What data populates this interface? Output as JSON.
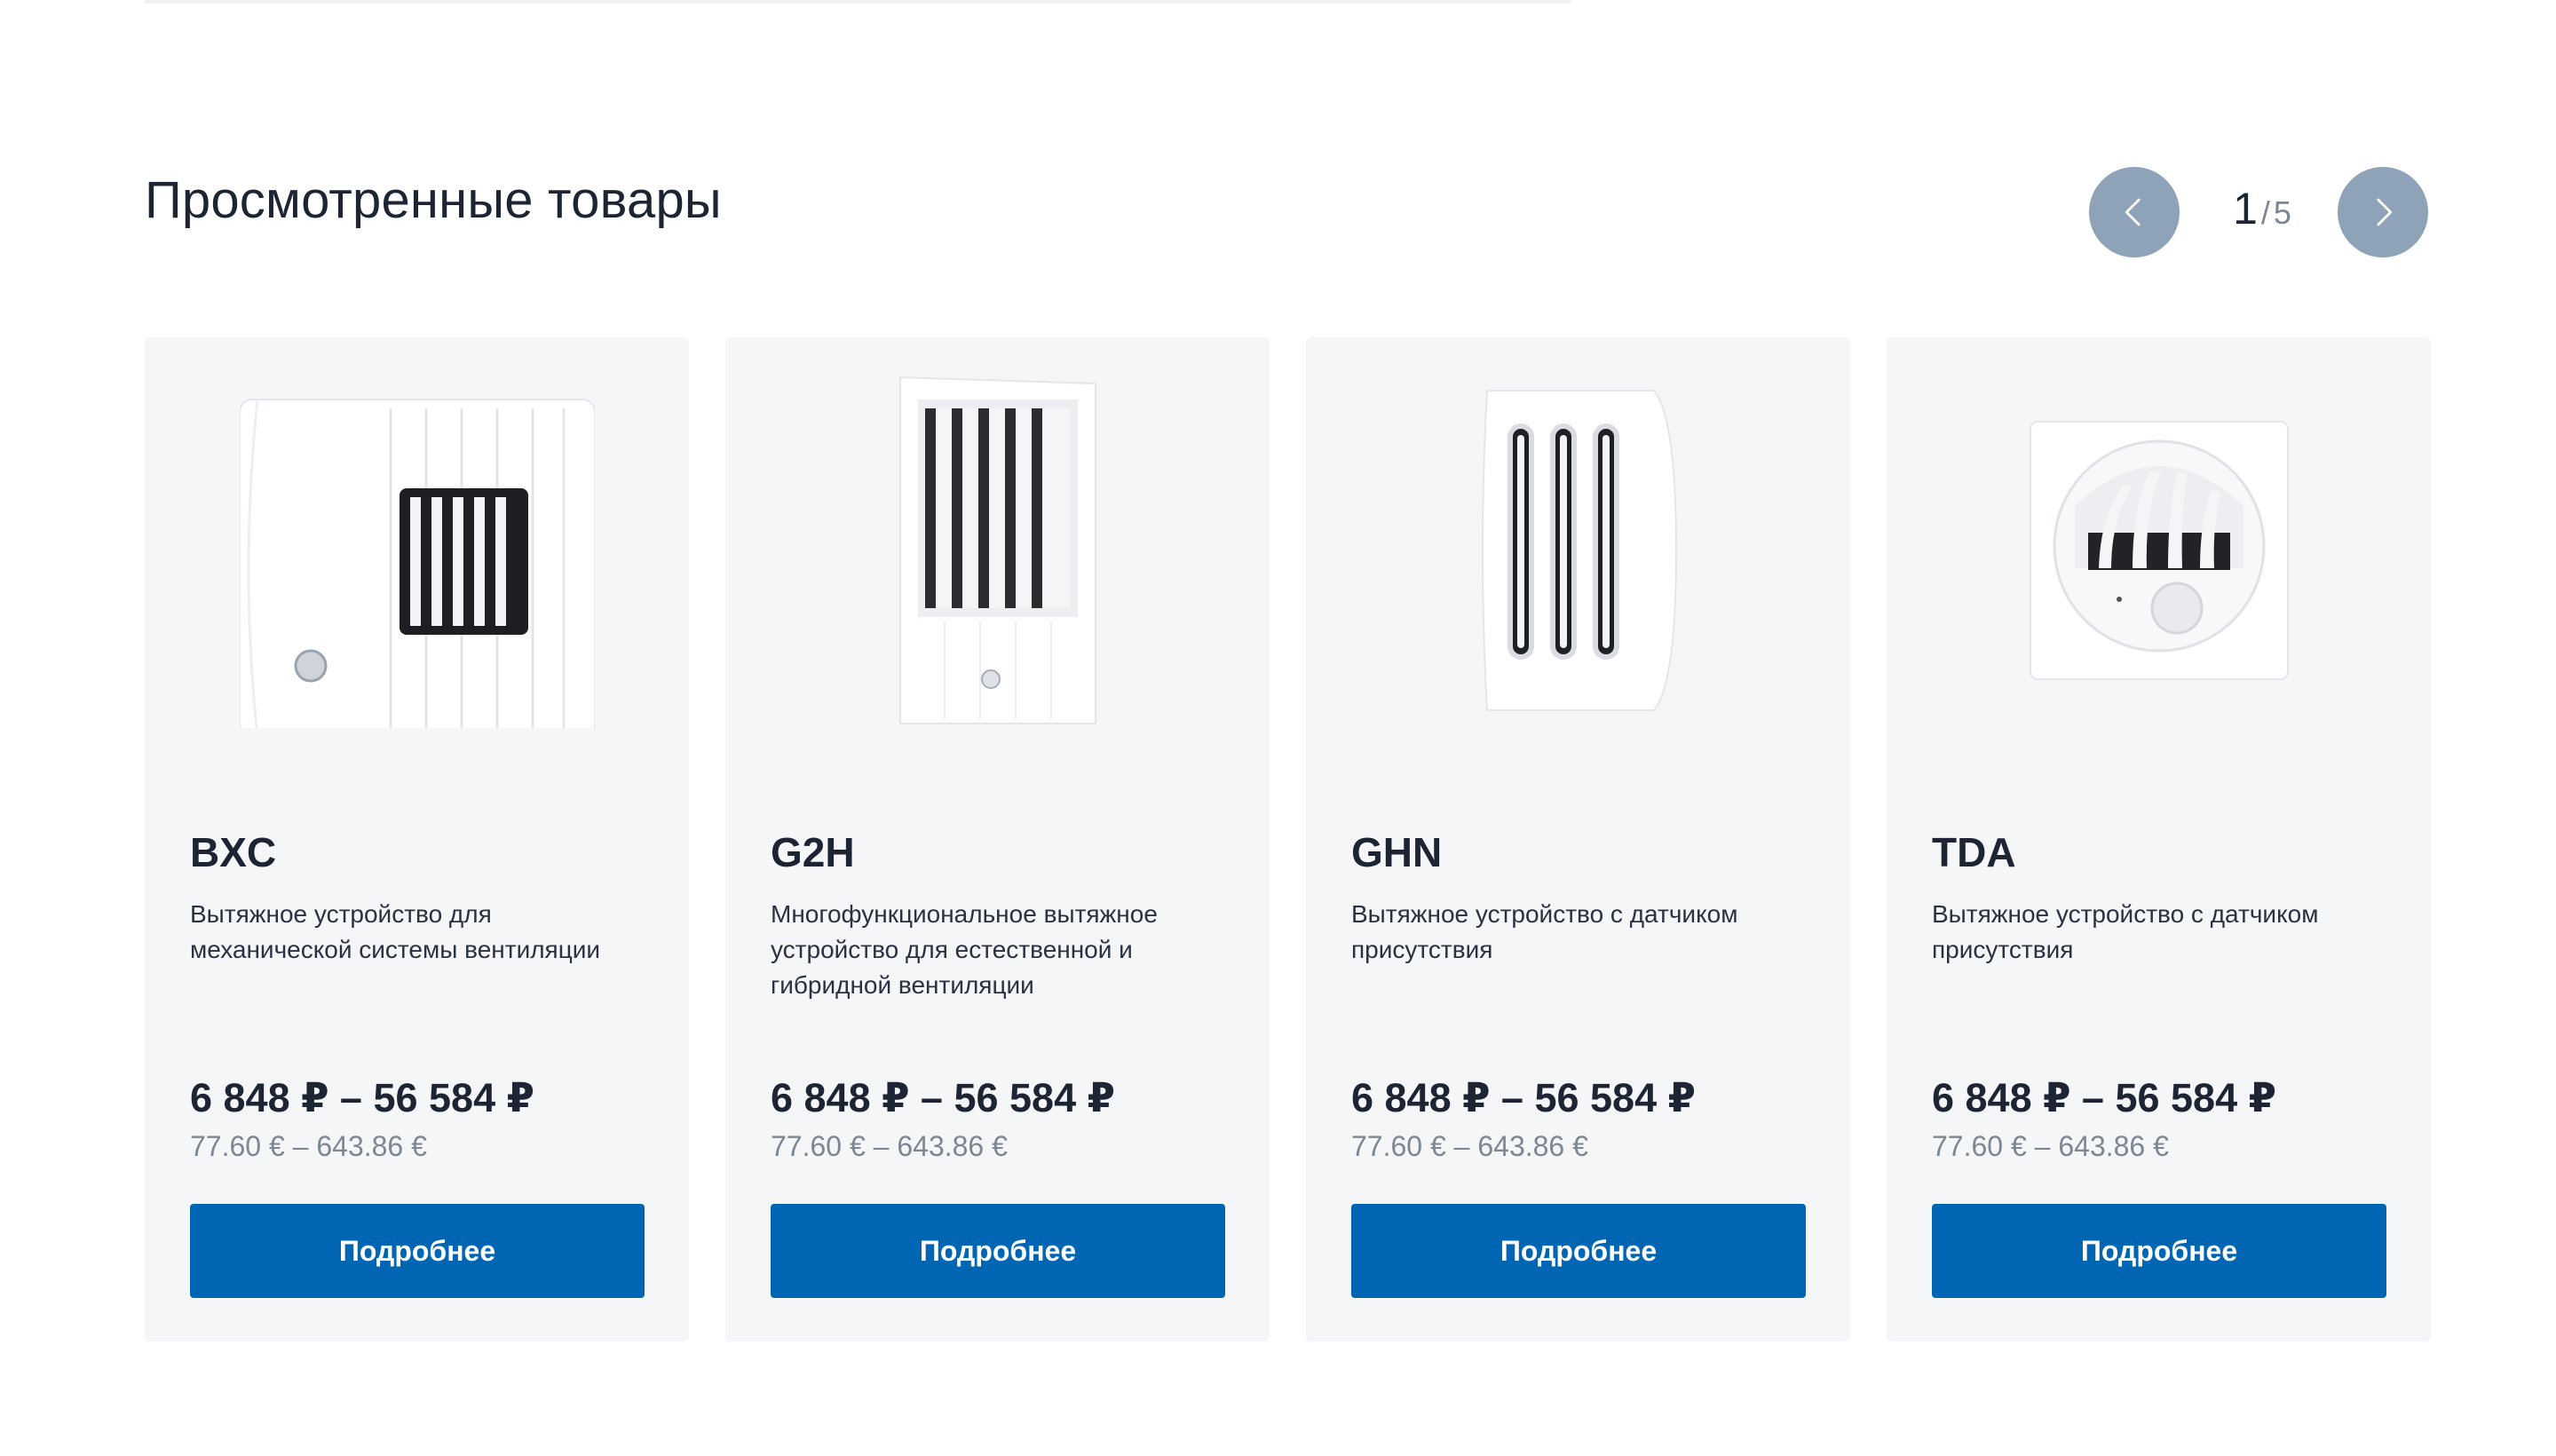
{
  "section": {
    "title": "Просмотренные товары"
  },
  "pager": {
    "current": "1",
    "separator": "/",
    "total": "5",
    "prev_icon": "chevron-left-icon",
    "next_icon": "chevron-right-icon",
    "button_color": "#8fa3b8"
  },
  "products": [
    {
      "name": "BXC",
      "description": "Вытяжное устройство для механической системы вентиляции",
      "price_rub": "6 848 ₽ – 56 584 ₽",
      "price_eur": "77.60 € – 643.86 €",
      "button_label": "Подробнее"
    },
    {
      "name": "G2H",
      "description": "Многофункциональное вытяжное устройство для естественной и гибридной вентиляции",
      "price_rub": "6 848 ₽ – 56 584 ₽",
      "price_eur": "77.60 € – 643.86 €",
      "button_label": "Подробнее"
    },
    {
      "name": "GHN",
      "description": "Вытяжное устройство с датчиком присутствия",
      "price_rub": "6 848 ₽ – 56 584 ₽",
      "price_eur": "77.60 € – 643.86 €",
      "button_label": "Подробнее"
    },
    {
      "name": "TDA",
      "description": "Вытяжное устройство с датчиком присутствия",
      "price_rub": "6 848 ₽ – 56 584 ₽",
      "price_eur": "77.60 € – 643.86 €",
      "button_label": "Подробнее"
    }
  ],
  "colors": {
    "primary_button": "#0065b3",
    "card_background": "#f5f6f8",
    "text_dark": "#1d2433",
    "text_muted": "#7d8794"
  }
}
